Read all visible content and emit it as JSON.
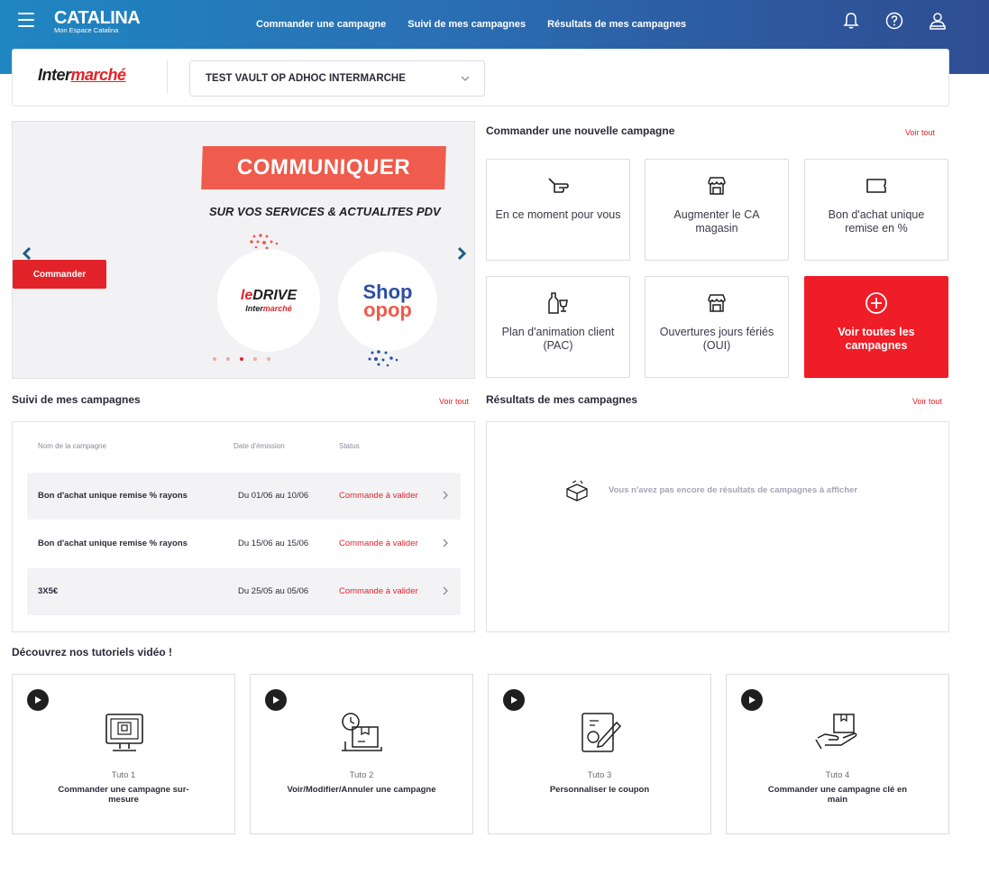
{
  "header": {
    "brand": "CATALINA",
    "brand_sub": "Mon Espace Catalina",
    "nav": [
      "Commander une campagne",
      "Suivi de mes campagnes",
      "Résultats de mes campagnes"
    ],
    "icons": [
      "bell-icon",
      "help-icon",
      "user-icon"
    ]
  },
  "store": {
    "logo_a": "Inter",
    "logo_b": "marché",
    "selected": "TEST VAULT OP ADHOC INTERMARCHE"
  },
  "carousel": {
    "title": "COMMUNIQUER",
    "subtitle": "SUR VOS SERVICES & ACTUALITES PDV",
    "drive_a": "le",
    "drive_b": "DRIVE",
    "drive_sub_a": "Inter",
    "drive_sub_b": "marché",
    "shop_line1": "Shop",
    "shop_line2": "opop",
    "button": "Commander",
    "slides": 5,
    "active_slide": 3
  },
  "order": {
    "title": "Commander une nouvelle campagne",
    "see_all": "Voir tout",
    "tiles": [
      {
        "label": "En ce moment pour vous",
        "icon": "pointing-hand-icon"
      },
      {
        "label": "Augmenter le CA magasin",
        "icon": "store-icon"
      },
      {
        "label": "Bon d'achat unique remise en %",
        "icon": "coupon-icon"
      },
      {
        "label": "Plan d'animation client (PAC)",
        "icon": "bottle-glass-icon"
      },
      {
        "label": "Ouvertures jours fériés (OUI)",
        "icon": "store-icon"
      },
      {
        "label": "Voir toutes les campagnes",
        "icon": "plus-circle-icon"
      }
    ]
  },
  "tracking": {
    "title": "Suivi de mes campagnes",
    "see_all": "Voir tout",
    "columns": [
      "Nom de la campagne",
      "Date d'émission",
      "Status"
    ],
    "rows": [
      {
        "name": "Bon d'achat unique remise % rayons",
        "date": "Du 01/06 au 10/06",
        "status": "Commande à valider"
      },
      {
        "name": "Bon d'achat unique remise % rayons",
        "date": "Du 15/06 au 15/06",
        "status": "Commande à valider"
      },
      {
        "name": "3X5€",
        "date": "Du 25/05 au 05/06",
        "status": "Commande à valider"
      }
    ]
  },
  "results": {
    "title": "Résultats de mes campagnes",
    "see_all": "Voir tout",
    "empty": "Vous n'avez pas encore de résultats de campagnes à afficher"
  },
  "tutorials": {
    "title": "Découvrez nos tutoriels vidéo !",
    "items": [
      {
        "num": "Tuto 1",
        "title": "Commander une campagne sur-mesure"
      },
      {
        "num": "Tuto 2",
        "title": "Voir/Modifier/Annuler une campagne"
      },
      {
        "num": "Tuto 3",
        "title": "Personnaliser le coupon"
      },
      {
        "num": "Tuto 4",
        "title": "Commander une campagne clé en main"
      }
    ]
  },
  "colors": {
    "accent": "#e3232a",
    "header_start": "#1f86c2",
    "header_end": "#2f4d92",
    "tile_red": "#ef1d27"
  }
}
